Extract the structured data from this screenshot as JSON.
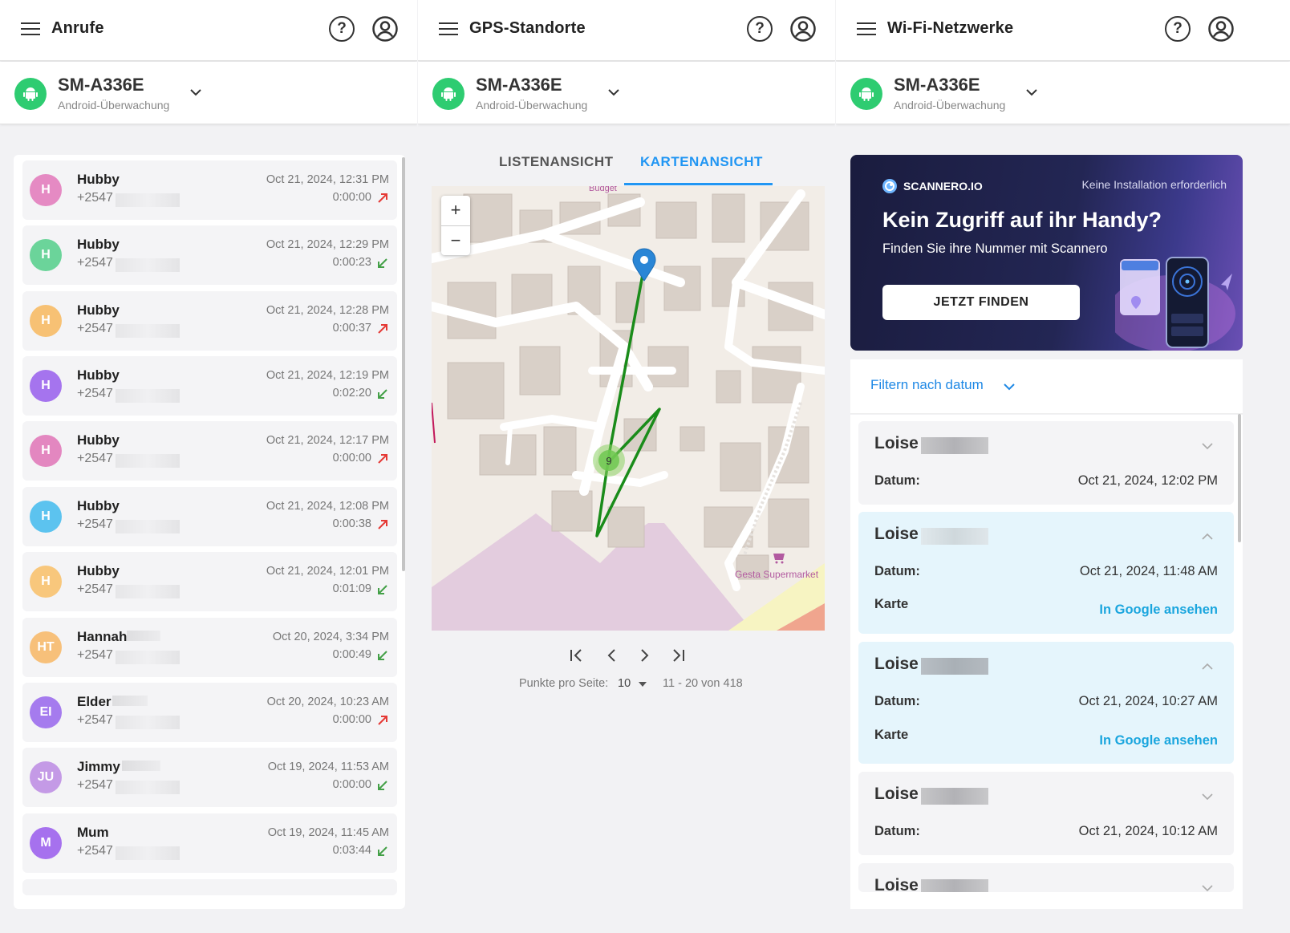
{
  "colors": {
    "accent": "#2196f3",
    "android_green": "#2ecc71",
    "outgoing": "#e53935",
    "incoming": "#43a047",
    "link": "#1ba6de"
  },
  "device": {
    "name": "SM-A336E",
    "sub": "Android-Überwachung"
  },
  "calls": {
    "title": "Anrufe",
    "items": [
      {
        "initials": "H",
        "name": "Hubby",
        "phone": "+2547",
        "date": "Oct 21, 2024, 12:31 PM",
        "duration": "0:00:00",
        "direction": "outgoing",
        "color": "#e58ac3"
      },
      {
        "initials": "H",
        "name": "Hubby",
        "phone": "+2547",
        "date": "Oct 21, 2024, 12:29 PM",
        "duration": "0:00:23",
        "direction": "incoming",
        "color": "#6bd49a"
      },
      {
        "initials": "H",
        "name": "Hubby",
        "phone": "+2547",
        "date": "Oct 21, 2024, 12:28 PM",
        "duration": "0:00:37",
        "direction": "outgoing",
        "color": "#f7c174"
      },
      {
        "initials": "H",
        "name": "Hubby",
        "phone": "+2547",
        "date": "Oct 21, 2024, 12:19 PM",
        "duration": "0:02:20",
        "direction": "incoming",
        "color": "#a574ee"
      },
      {
        "initials": "H",
        "name": "Hubby",
        "phone": "+2547",
        "date": "Oct 21, 2024, 12:17 PM",
        "duration": "0:00:00",
        "direction": "outgoing",
        "color": "#e387c0"
      },
      {
        "initials": "H",
        "name": "Hubby",
        "phone": "+2547",
        "date": "Oct 21, 2024, 12:08 PM",
        "duration": "0:00:38",
        "direction": "outgoing",
        "color": "#5cc3ef"
      },
      {
        "initials": "H",
        "name": "Hubby",
        "phone": "+2547",
        "date": "Oct 21, 2024, 12:01 PM",
        "duration": "0:01:09",
        "direction": "incoming",
        "color": "#f8c77c"
      },
      {
        "initials": "HT",
        "name": "Hannah",
        "phone": "+2547",
        "date": "Oct 20, 2024, 3:34 PM",
        "duration": "0:00:49",
        "direction": "incoming",
        "color": "#f7c07a"
      },
      {
        "initials": "EI",
        "name": "Elder",
        "phone": "+2547",
        "date": "Oct 20, 2024, 10:23 AM",
        "duration": "0:00:00",
        "direction": "outgoing",
        "color": "#a57bee"
      },
      {
        "initials": "JU",
        "name": "Jimmy",
        "phone": "+2547",
        "date": "Oct 19, 2024, 11:53 AM",
        "duration": "0:00:00",
        "direction": "incoming",
        "color": "#c49ae6"
      },
      {
        "initials": "M",
        "name": "Mum",
        "phone": "+2547",
        "date": "Oct 19, 2024, 11:45 AM",
        "duration": "0:03:44",
        "direction": "incoming",
        "color": "#a671ee"
      }
    ]
  },
  "gps": {
    "title": "GPS-Standorte",
    "tab_list": "LISTENANSICHT",
    "tab_map": "KARTENANSICHT",
    "map": {
      "label_budget": "Budget",
      "label_market": "Gesta Supermarket",
      "cluster_count": "9",
      "zoom_in": "+",
      "zoom_out": "−"
    },
    "pager": {
      "per_page_label": "Punkte pro Seite:",
      "per_page": "10",
      "range": "11 - 20 von 418"
    }
  },
  "wifi": {
    "title": "Wi-Fi-Netzwerke",
    "ad": {
      "brand": "SCANNERO.IO",
      "no_install": "Keine Installation erforderlich",
      "headline": "Kein Zugriff auf ihr Handy?",
      "sub": "Finden Sie ihre Nummer mit Scannero",
      "button": "JETZT FINDEN"
    },
    "filter": "Filtern nach datum",
    "date_label": "Datum:",
    "map_label": "Karte",
    "google_link": "In Google ansehen",
    "items": [
      {
        "name": "Loise",
        "date": "Oct 21, 2024, 12:02 PM",
        "expanded": false
      },
      {
        "name": "Loise",
        "date": "Oct 21, 2024, 11:48 AM",
        "expanded": true
      },
      {
        "name": "Loise",
        "date": "Oct 21, 2024, 10:27 AM",
        "expanded": true
      },
      {
        "name": "Loise",
        "date": "Oct 21, 2024, 10:12 AM",
        "expanded": false
      },
      {
        "name": "Loise"
      }
    ]
  }
}
